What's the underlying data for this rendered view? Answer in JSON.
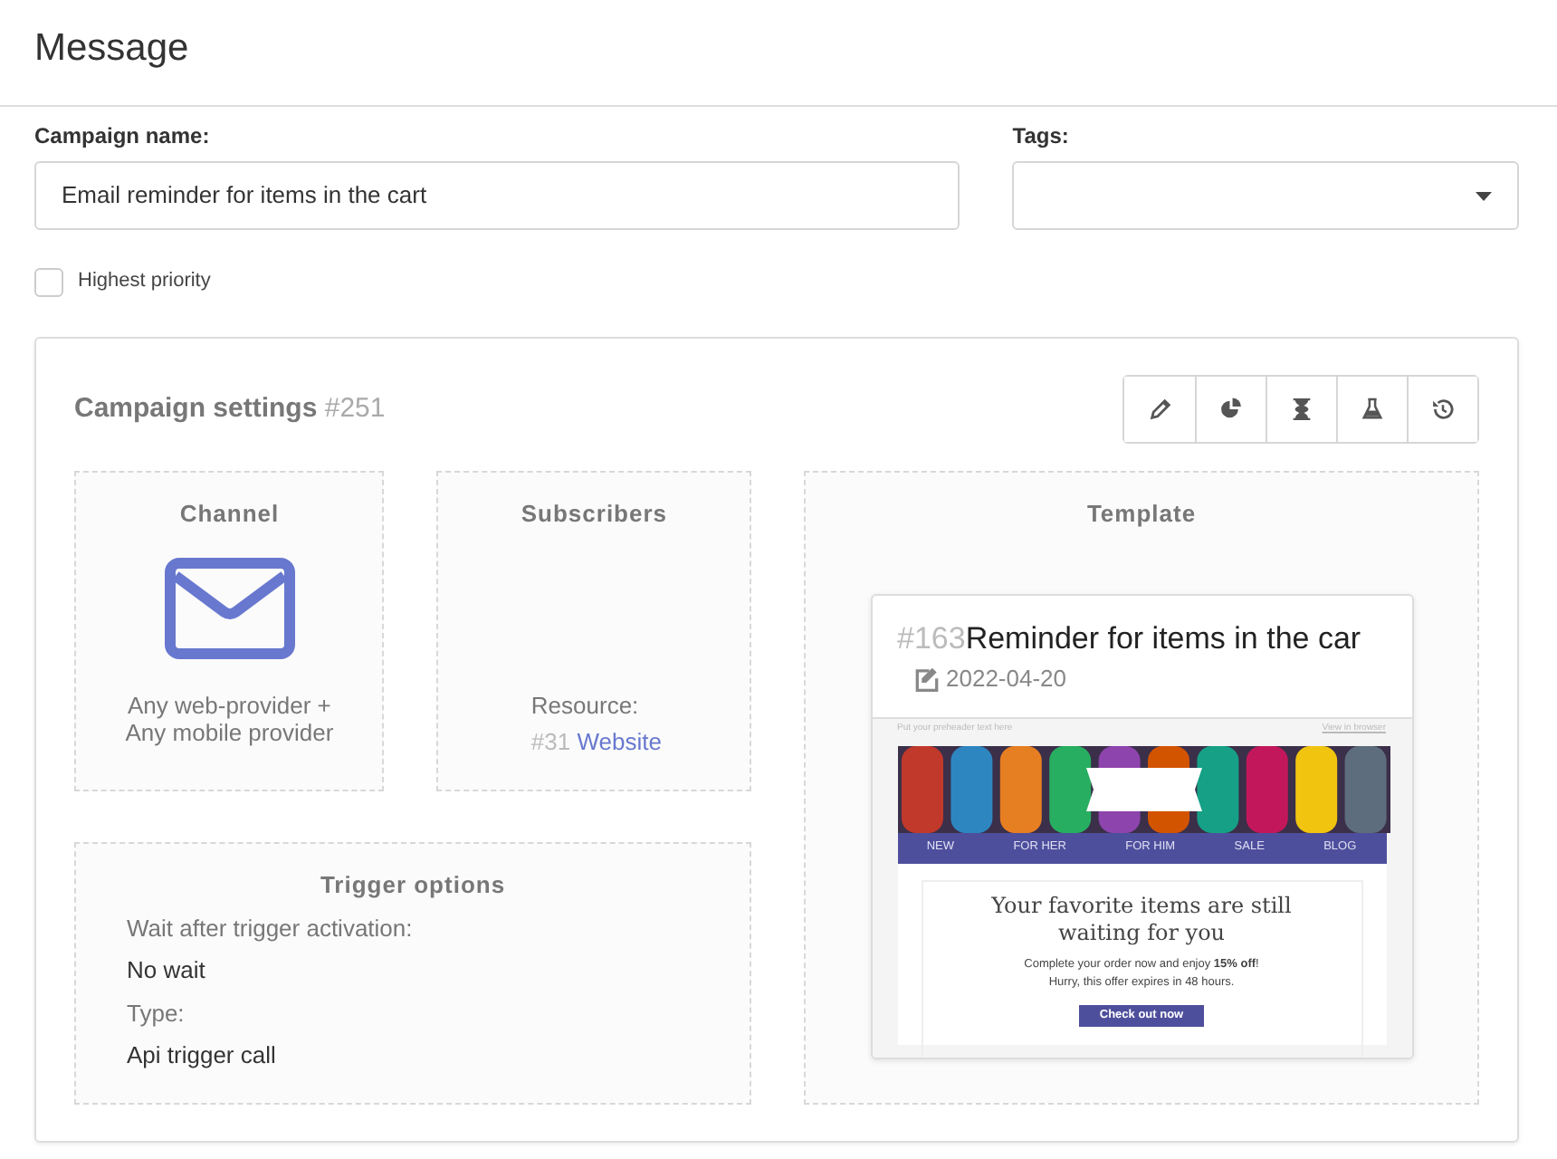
{
  "header": {
    "title": "Message"
  },
  "form": {
    "campaign_name": {
      "label": "Campaign name:",
      "value": "Email reminder for items in the cart"
    },
    "tags": {
      "label": "Tags:"
    },
    "priority": {
      "label": "Highest priority",
      "checked": false
    }
  },
  "settings": {
    "title": "Campaign settings",
    "id": "#251",
    "toolbar": [
      {
        "kind": "edit"
      },
      {
        "kind": "stats"
      },
      {
        "kind": "schedule"
      },
      {
        "kind": "test"
      },
      {
        "kind": "history"
      }
    ]
  },
  "channel": {
    "title": "Channel",
    "lines": [
      "Any web-provider +",
      "Any mobile provider"
    ]
  },
  "subscribers": {
    "title": "Subscribers",
    "resource_label": "Resource:",
    "resource_id": "#31",
    "resource_link": "Website"
  },
  "trigger": {
    "title": "Trigger options",
    "fields": [
      {
        "label": "Wait after trigger activation:",
        "value": "No wait"
      },
      {
        "label": "Type:",
        "value": "Api trigger call"
      }
    ]
  },
  "template": {
    "title": "Template",
    "id": "#163",
    "name": "Reminder for items in the car",
    "date": "2022-04-20",
    "email": {
      "preheader": "Put your preheader text here",
      "view_link": "View in browser",
      "menu": [
        "NEW",
        "FOR HER",
        "FOR HIM",
        "SALE",
        "BLOG"
      ],
      "heading": "Your favorite items are still waiting for you",
      "body": "Complete your order now and enjoy **15% off**!",
      "note": "Hurry, this offer expires in 48 hours.",
      "button": "Check out now"
    }
  }
}
